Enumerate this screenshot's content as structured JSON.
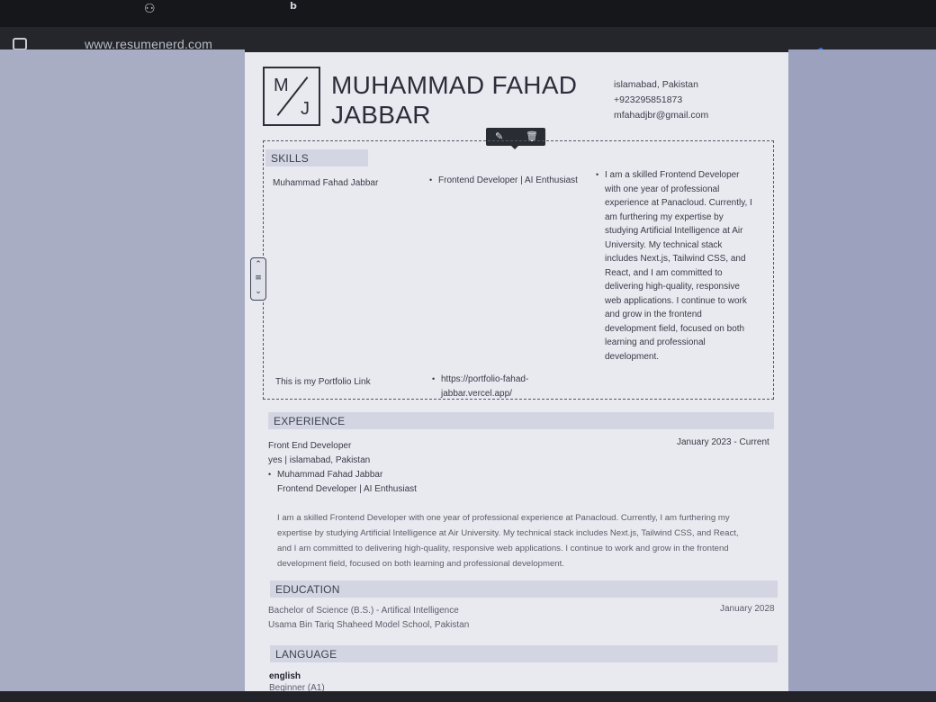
{
  "browser": {
    "url": "www.resumenerd.com",
    "top_icon_b": "b"
  },
  "resume": {
    "monogram": {
      "first": "M",
      "last": "J"
    },
    "name_line1": "MUHAMMAD FAHAD",
    "name_line2": "JABBAR",
    "contact": {
      "location": "islamabad, Pakistan",
      "phone": "+923295851873",
      "email": "mfahadjbr@gmail.com"
    },
    "skills": {
      "heading": "SKILLS",
      "row1": {
        "col1": "Muhammad Fahad Jabbar",
        "col2": "Frontend Developer | AI Enthusiast",
        "col3_lines": [
          "I am a skilled Frontend Developer",
          "with one year of professional",
          "experience at Panacloud. Currently, I",
          "am furthering my expertise by",
          "studying Artificial Intelligence at Air",
          "University. My technical stack",
          "includes Next.js, Tailwind CSS, and",
          "React, and I am committed to",
          "delivering high-quality, responsive",
          "web applications. I continue to work",
          "and grow in the frontend",
          "development field, focused on both",
          "learning and professional",
          "development."
        ]
      },
      "row2": {
        "col1": "This is my Portfolio Link",
        "col2_line1": "https://portfolio-fahad-",
        "col2_line2": "jabbar.vercel.app/"
      }
    },
    "experience": {
      "heading": "EXPERIENCE",
      "title": "Front End Developer",
      "dates": "January 2023 - Current",
      "location": "yes | islamabad, Pakistan",
      "bullet_line1": "Muhammad Fahad Jabbar",
      "bullet_line2": "Frontend Developer | AI Enthusiast",
      "summary_lines": [
        "I am a skilled Frontend Developer with one year of professional experience at Panacloud. Currently, I am furthering my",
        "expertise by studying Artificial Intelligence at Air University. My technical stack includes Next.js, Tailwind CSS, and React,",
        "and I am committed to delivering high-quality, responsive web applications. I continue to work and grow in the frontend",
        "development field, focused on both learning and professional development."
      ]
    },
    "education": {
      "heading": "EDUCATION",
      "degree": "Bachelor of Science (B.S.) - Artifical Intelligence",
      "school": "Usama Bin Tariq Shaheed Model School, Pakistan",
      "date": "January 2028"
    },
    "language": {
      "heading": "LANGUAGE",
      "name": "english",
      "level": "Beginner (A1)"
    }
  }
}
